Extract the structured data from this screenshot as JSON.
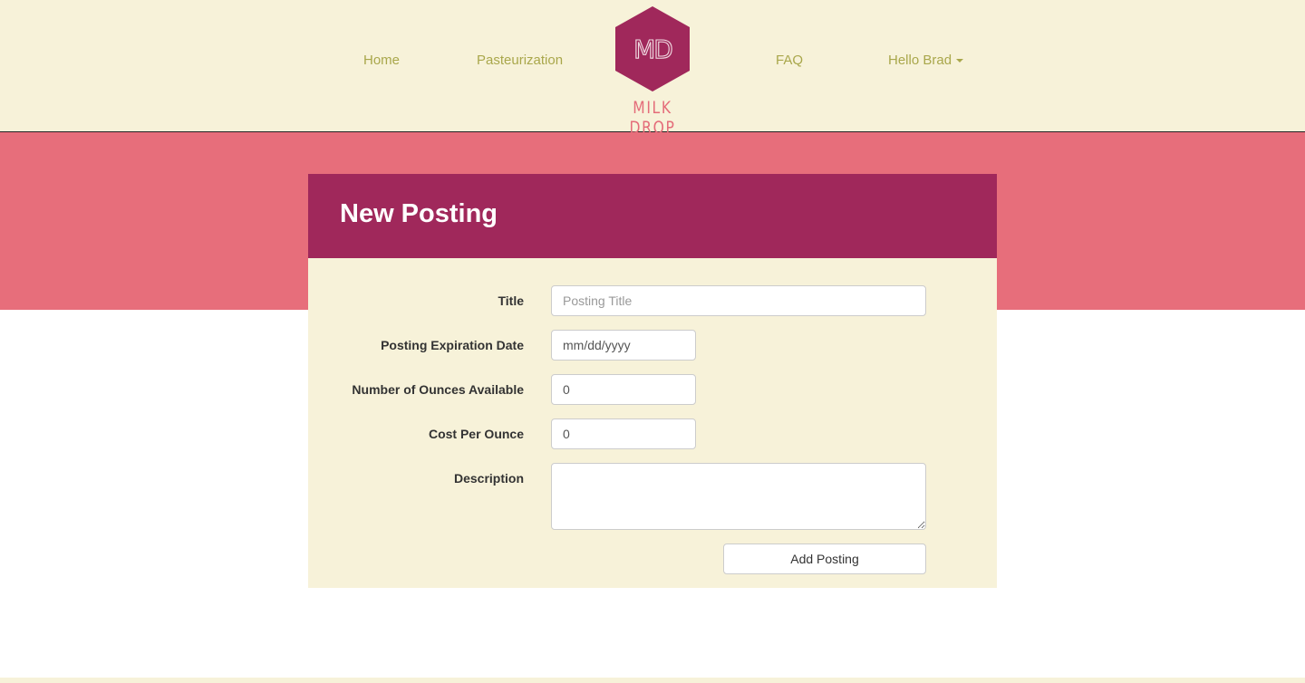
{
  "colors": {
    "nav_background": "#f7f2d9",
    "nav_link": "#a9a74b",
    "brand_plum": "#a0285b",
    "brand_pink": "#e76e7b",
    "logo_text": "#e46c79"
  },
  "nav": {
    "home": "Home",
    "pasteurization": "Pasteurization",
    "faq": "FAQ",
    "user_menu": "Hello Brad",
    "user_menu_icon": "caret-down-icon"
  },
  "logo": {
    "monogram": "MD",
    "wordmark": "MILK DROP"
  },
  "form": {
    "heading": "New Posting",
    "fields": {
      "title": {
        "label": "Title",
        "placeholder": "Posting Title",
        "value": ""
      },
      "expiration": {
        "label": "Posting Expiration Date",
        "value": "mm/dd/yyyy"
      },
      "ounces": {
        "label": "Number of Ounces Available",
        "value": "0"
      },
      "cost": {
        "label": "Cost Per Ounce",
        "value": "0"
      },
      "description": {
        "label": "Description",
        "value": ""
      }
    },
    "submit_label": "Add Posting"
  }
}
